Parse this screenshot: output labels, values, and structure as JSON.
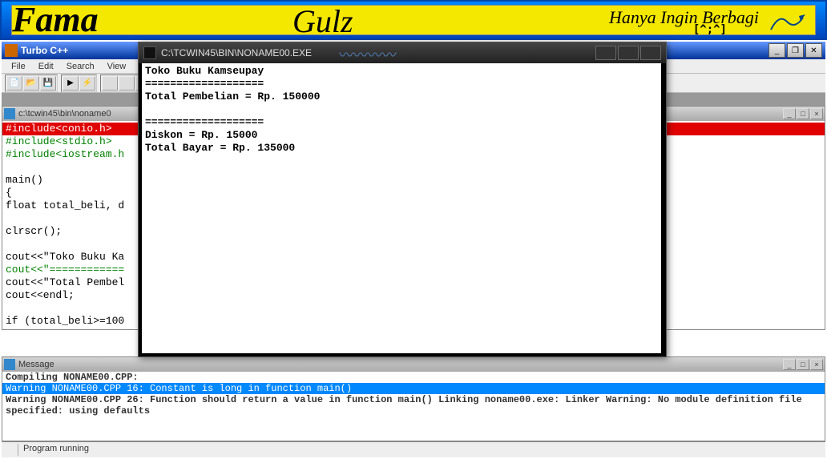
{
  "banner": {
    "left": "Fama",
    "center": "Gulz",
    "right": "Hanya Ingin Berbagi",
    "emote": "[^;^]"
  },
  "ide": {
    "title": "Turbo C++",
    "menu": [
      "File",
      "Edit",
      "Search",
      "View"
    ],
    "editor_path": "c:\\tcwin45\\bin\\noname0",
    "code_lines": {
      "l1": "#include<conio.h>",
      "l2": "#include<stdio.h>",
      "l3": "#include<iostream.h",
      "l4": "",
      "l5": "main()",
      "l6": "{",
      "l7": "float total_beli, d",
      "l8": "",
      "l9": "clrscr();",
      "l10": "",
      "l11": "cout<<\"Toko Buku Ka",
      "l12": "cout<<\"============",
      "l13": "cout<<\"Total Pembel",
      "l14": "cout<<endl;",
      "l15": "",
      "l16": "if (total_beli>=100"
    },
    "messages": {
      "title": "Message",
      "m1": "Compiling NONAME00.CPP:",
      "m2": "Warning NONAME00.CPP 16: Constant is long in function main()",
      "m3": "Warning NONAME00.CPP 26: Function should return a value in function main()",
      "m4": "Linking noname00.exe:",
      "m5": "Linker Warning: No module definition file specified: using defaults"
    },
    "status": "Program running"
  },
  "console": {
    "title": "C:\\TCWIN45\\BIN\\NONAME00.EXE",
    "lines": {
      "l1": "Toko Buku Kamseupay",
      "l2": "===================",
      "l3": "Total Pembelian = Rp. 150000",
      "l4": "",
      "l5": "===================",
      "l6": "Diskon = Rp. 15000",
      "l7": "Total Bayar = Rp. 135000"
    }
  }
}
